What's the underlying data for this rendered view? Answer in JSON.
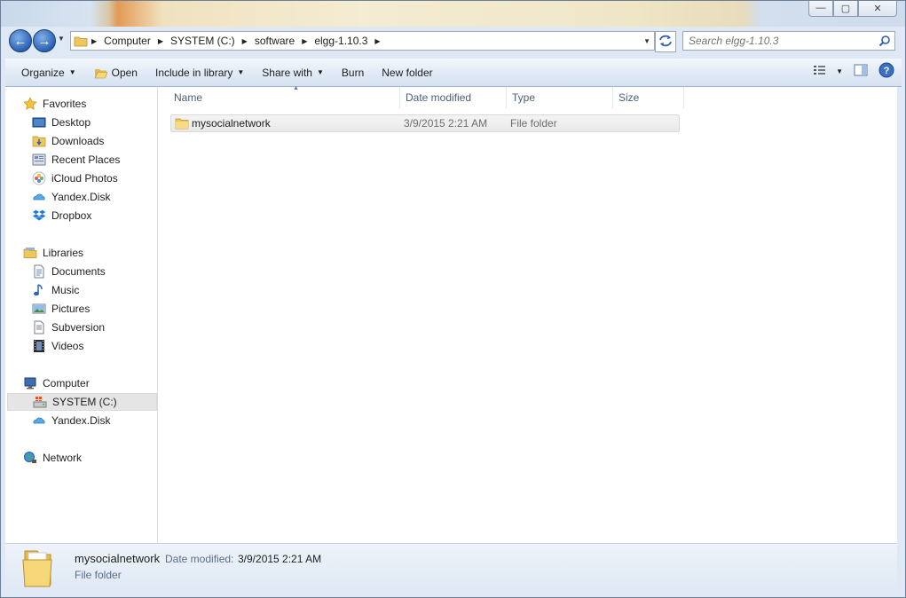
{
  "window": {
    "minimize_label": "—",
    "maximize_label": "▢",
    "close_label": "✕"
  },
  "address": {
    "crumbs": [
      "Computer",
      "SYSTEM (C:)",
      "software",
      "elgg-1.10.3"
    ]
  },
  "search": {
    "placeholder": "Search elgg-1.10.3"
  },
  "toolbar": {
    "organize": "Organize",
    "open": "Open",
    "include_in_library": "Include in library",
    "share_with": "Share with",
    "burn": "Burn",
    "new_folder": "New folder"
  },
  "nav": {
    "favorites": "Favorites",
    "desktop": "Desktop",
    "downloads": "Downloads",
    "recent_places": "Recent Places",
    "icloud_photos": "iCloud Photos",
    "yandex_disk": "Yandex.Disk",
    "dropbox": "Dropbox",
    "libraries": "Libraries",
    "documents": "Documents",
    "music": "Music",
    "pictures": "Pictures",
    "subversion": "Subversion",
    "videos": "Videos",
    "computer": "Computer",
    "system_c": "SYSTEM (C:)",
    "yandex_disk_2": "Yandex.Disk",
    "network": "Network"
  },
  "columns": {
    "name": "Name",
    "date_modified": "Date modified",
    "type": "Type",
    "size": "Size"
  },
  "files": [
    {
      "name": "mysocialnetwork",
      "date": "3/9/2015 2:21 AM",
      "type": "File folder",
      "size": ""
    }
  ],
  "details": {
    "name": "mysocialnetwork",
    "date_label": "Date modified:",
    "date_value": "3/9/2015 2:21 AM",
    "type": "File folder"
  },
  "colors": {
    "accent": "#2b62b3",
    "folder": "#f0c75a",
    "selection": "#e5e5e5"
  }
}
